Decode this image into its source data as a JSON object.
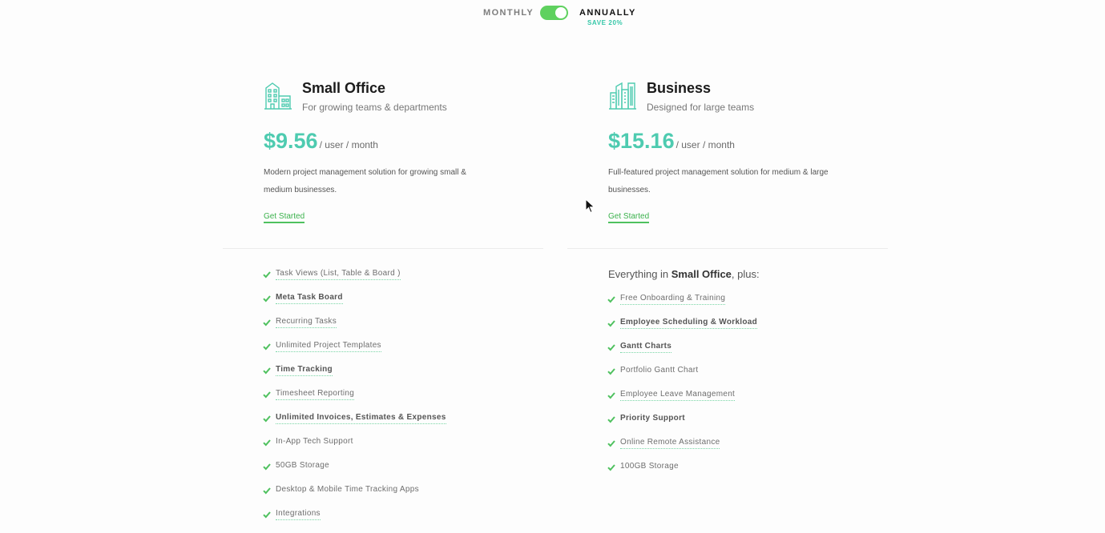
{
  "billing": {
    "monthly_label": "MONTHLY",
    "annually_label": "ANNUALLY",
    "save_label": "SAVE 20%",
    "selected": "annually"
  },
  "colors": {
    "accent_teal": "#4ecbb0",
    "toggle_green": "#5fd15f",
    "cta_green": "#3cb24d",
    "check_green": "#4fc15f"
  },
  "plans": {
    "small": {
      "icon": "small-office-building-icon",
      "name": "Small Office",
      "tagline": "For growing teams & departments",
      "price": "$9.56",
      "unit": "/ user / month",
      "description": "Modern project management solution for growing small & medium businesses.",
      "cta": "Get Started",
      "features": [
        {
          "label": "Task Views (List, Table & Board )",
          "bold": false,
          "link": true
        },
        {
          "label": "Meta Task Board",
          "bold": true,
          "link": true
        },
        {
          "label": "Recurring Tasks",
          "bold": false,
          "link": true
        },
        {
          "label": "Unlimited Project Templates",
          "bold": false,
          "link": true
        },
        {
          "label": "Time Tracking",
          "bold": true,
          "link": true
        },
        {
          "label": "Timesheet Reporting",
          "bold": false,
          "link": true
        },
        {
          "label": "Unlimited Invoices, Estimates & Expenses",
          "bold": true,
          "link": true
        },
        {
          "label": "In-App Tech Support",
          "bold": false,
          "link": false
        },
        {
          "label": "50GB Storage",
          "bold": false,
          "link": false
        },
        {
          "label": "Desktop & Mobile Time Tracking Apps",
          "bold": false,
          "link": false
        },
        {
          "label": "Integrations",
          "bold": false,
          "link": true
        }
      ]
    },
    "business": {
      "icon": "business-skyscraper-icon",
      "name": "Business",
      "tagline": "Designed for large teams",
      "price": "$15.16",
      "unit": "/ user / month",
      "description": "Full-featured project management solution for medium & large businesses.",
      "cta": "Get Started",
      "intro_prefix": "Everything in ",
      "intro_bold": "Small Office",
      "intro_suffix": ", plus:",
      "features": [
        {
          "label": "Free Onboarding & Training",
          "bold": false,
          "link": true
        },
        {
          "label": "Employee Scheduling & Workload",
          "bold": true,
          "link": true
        },
        {
          "label": "Gantt Charts",
          "bold": true,
          "link": true
        },
        {
          "label": "Portfolio Gantt Chart",
          "bold": false,
          "link": false
        },
        {
          "label": "Employee Leave Management",
          "bold": false,
          "link": true
        },
        {
          "label": "Priority Support",
          "bold": true,
          "link": false
        },
        {
          "label": "Online Remote Assistance",
          "bold": false,
          "link": true
        },
        {
          "label": "100GB Storage",
          "bold": false,
          "link": false
        }
      ]
    }
  }
}
